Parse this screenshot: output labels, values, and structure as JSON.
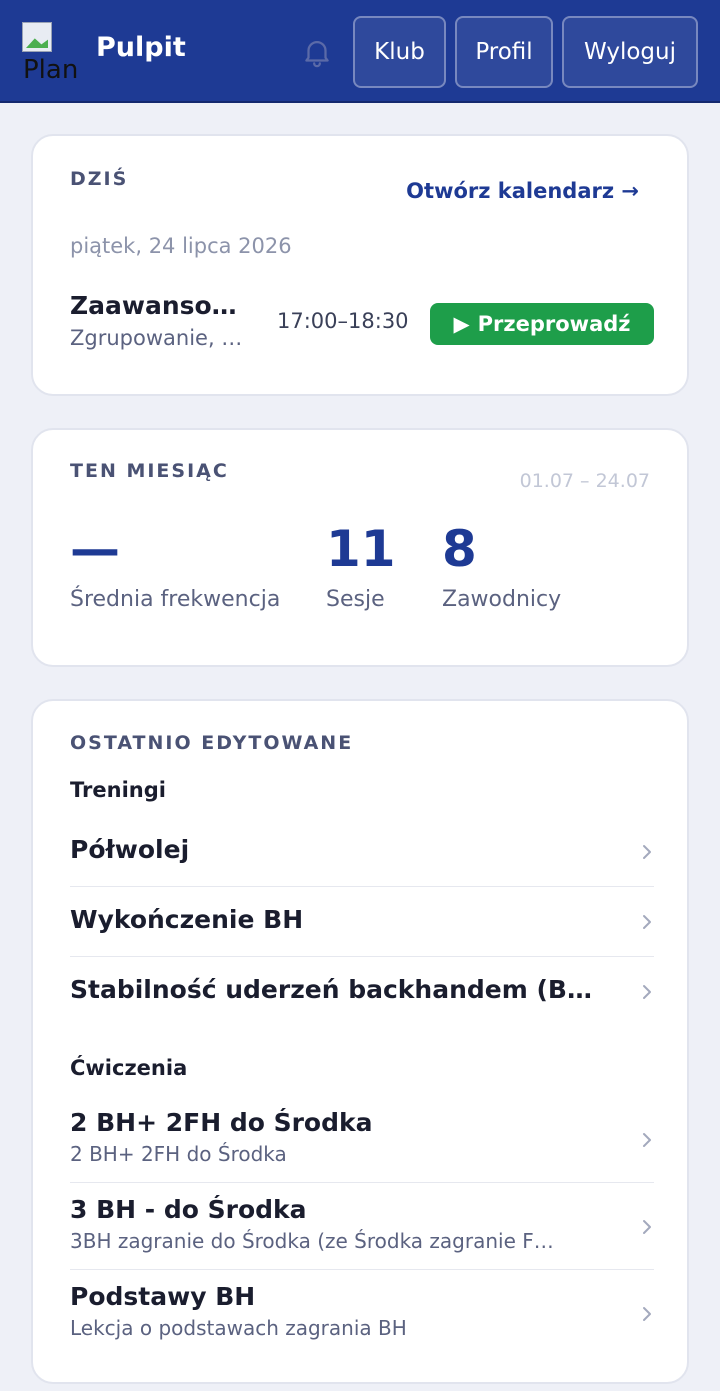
{
  "header": {
    "logo_alt": "Plan",
    "title": "Pulpit",
    "nav": [
      {
        "label": "Klub"
      },
      {
        "label": "Profil"
      },
      {
        "label": "Wyloguj"
      }
    ]
  },
  "today": {
    "label": "DZIŚ",
    "calendar_link": "Otwórz kalendarz →",
    "date": "piątek, 24 lipca 2026",
    "session": {
      "title": "Zaawanso…",
      "subtitle": "Zgrupowanie, …",
      "time": "17:00–18:30",
      "action_icon": "▶",
      "action_label": "Przeprowadź"
    }
  },
  "month": {
    "label": "TEN MIESIĄC",
    "range": "01.07 – 24.07",
    "stats": [
      {
        "value": "—",
        "label": "Średnia frekwencja"
      },
      {
        "value": "11",
        "label": "Sesje"
      },
      {
        "value": "8",
        "label": "Zawodnicy"
      }
    ]
  },
  "recent": {
    "label": "OSTATNIO EDYTOWANE",
    "trainings_label": "Treningi",
    "trainings": [
      {
        "title": "Półwolej"
      },
      {
        "title": "Wykończenie BH"
      },
      {
        "title": "Stabilność uderzeń backhandem (B…"
      }
    ],
    "exercises_label": "Ćwiczenia",
    "exercises": [
      {
        "title": "2 BH+ 2FH do Środka",
        "subtitle": "2 BH+ 2FH do Środka"
      },
      {
        "title": "3 BH - do Środka",
        "subtitle": "3BH zagranie do Środka (ze Środka zagranie F…"
      },
      {
        "title": "Podstawy BH",
        "subtitle": "Lekcja o podstawach zagrania BH"
      }
    ]
  },
  "colors": {
    "header": "#1e3a94",
    "accent": "#1e3a94",
    "success": "#1e9e4a",
    "background": "#eef0f7"
  }
}
